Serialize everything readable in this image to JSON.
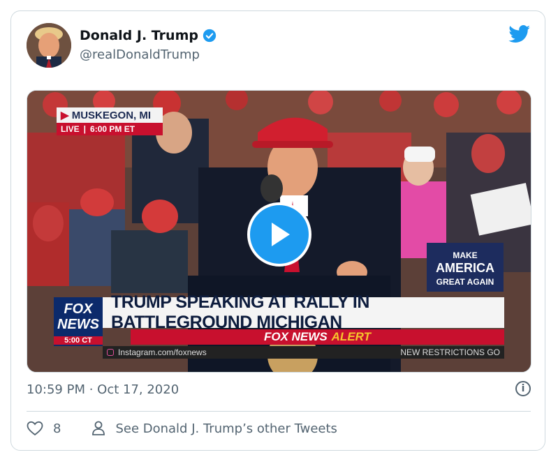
{
  "tweet": {
    "display_name": "Donald J. Trump",
    "handle": "@realDonaldTrump",
    "timestamp": "10:59 PM · Oct 17, 2020",
    "like_count": "8",
    "see_other_label": "See Donald J. Trump’s other Tweets",
    "brand_color": "#1d9bf0"
  },
  "video": {
    "location": "MUSKEGON, MI",
    "live_label": "LIVE",
    "live_time": "6:00 PM ET",
    "network_top": "FOX",
    "network_bottom": "NEWS",
    "network_time": "5:00 CT",
    "headline": "TRUMP SPEAKING AT RALLY IN BATTLEGROUND MICHIGAN",
    "alert_brand": "FOX NEWS",
    "alert_word": "ALERT",
    "instagram": "Instagram.com/foxnews",
    "ticker_right": "NEW RESTRICTIONS GO",
    "hat_text": "MAKE AMERICA GREAT AGAIN",
    "sign_text": "MAKE AMERICA GREAT AGAIN"
  },
  "icons": [
    "verified-badge-icon",
    "twitter-bird-icon",
    "play-icon",
    "info-icon",
    "heart-icon",
    "person-icon"
  ]
}
